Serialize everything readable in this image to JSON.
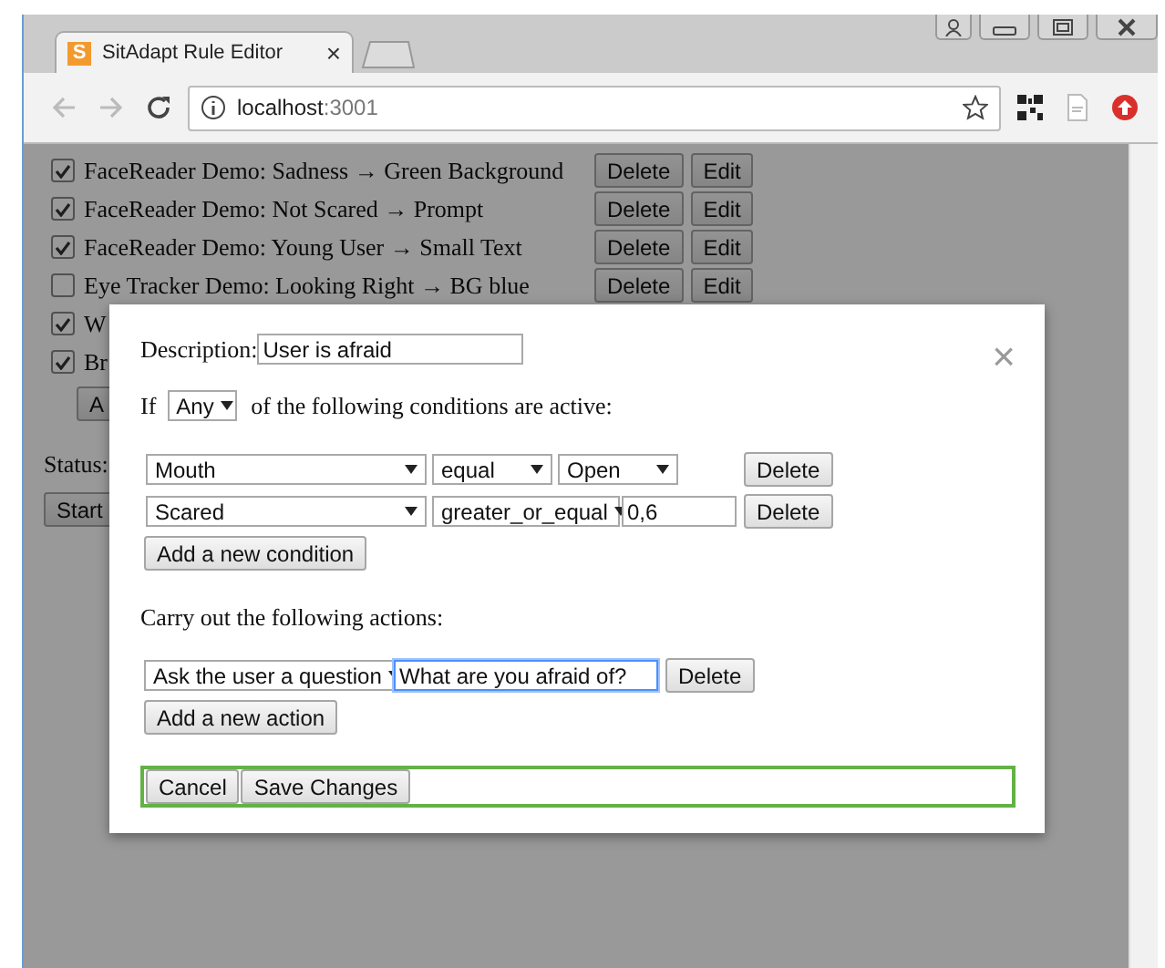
{
  "window": {
    "tab": {
      "favicon_letter": "S",
      "title": "SitAdapt Rule Editor",
      "close": "×"
    },
    "address": {
      "host": "localhost",
      "port": ":3001"
    }
  },
  "rules": [
    {
      "checked": true,
      "label": "FaceReader Demo: Sadness → Green Background",
      "buttons": [
        "Delete",
        "Edit"
      ]
    },
    {
      "checked": true,
      "label": "FaceReader Demo: Not Scared → Prompt",
      "buttons": [
        "Delete",
        "Edit"
      ]
    },
    {
      "checked": true,
      "label": "FaceReader Demo: Young User → Small Text",
      "buttons": [
        "Delete",
        "Edit"
      ]
    },
    {
      "checked": false,
      "label": "Eye Tracker Demo: Looking Right → BG blue",
      "buttons": [
        "Delete",
        "Edit"
      ]
    },
    {
      "checked": true,
      "label": "W"
    },
    {
      "checked": true,
      "label": "Br"
    }
  ],
  "add_rule_button": "A",
  "status_label": "Status:",
  "start_button": "Start",
  "dialog": {
    "close": "×",
    "description_label": "Description:",
    "description_value": "User is afraid",
    "if_label": "If",
    "match": "Any",
    "match_suffix": "of the following conditions are active:",
    "conditions": [
      {
        "field": "Mouth",
        "operator": "equal",
        "kind": "select",
        "value": "Open",
        "delete": "Delete"
      },
      {
        "field": "Scared",
        "operator": "greater_or_equal",
        "kind": "input",
        "value": "0,6",
        "delete": "Delete"
      }
    ],
    "add_condition": "Add a new condition",
    "actions_heading": "Carry out the following actions:",
    "actions": [
      {
        "type": "Ask the user a question",
        "value": "What are you afraid of?",
        "focused": true,
        "delete": "Delete"
      }
    ],
    "add_action": "Add a new action",
    "footer_buttons": [
      "Cancel",
      "Save Changes"
    ]
  }
}
